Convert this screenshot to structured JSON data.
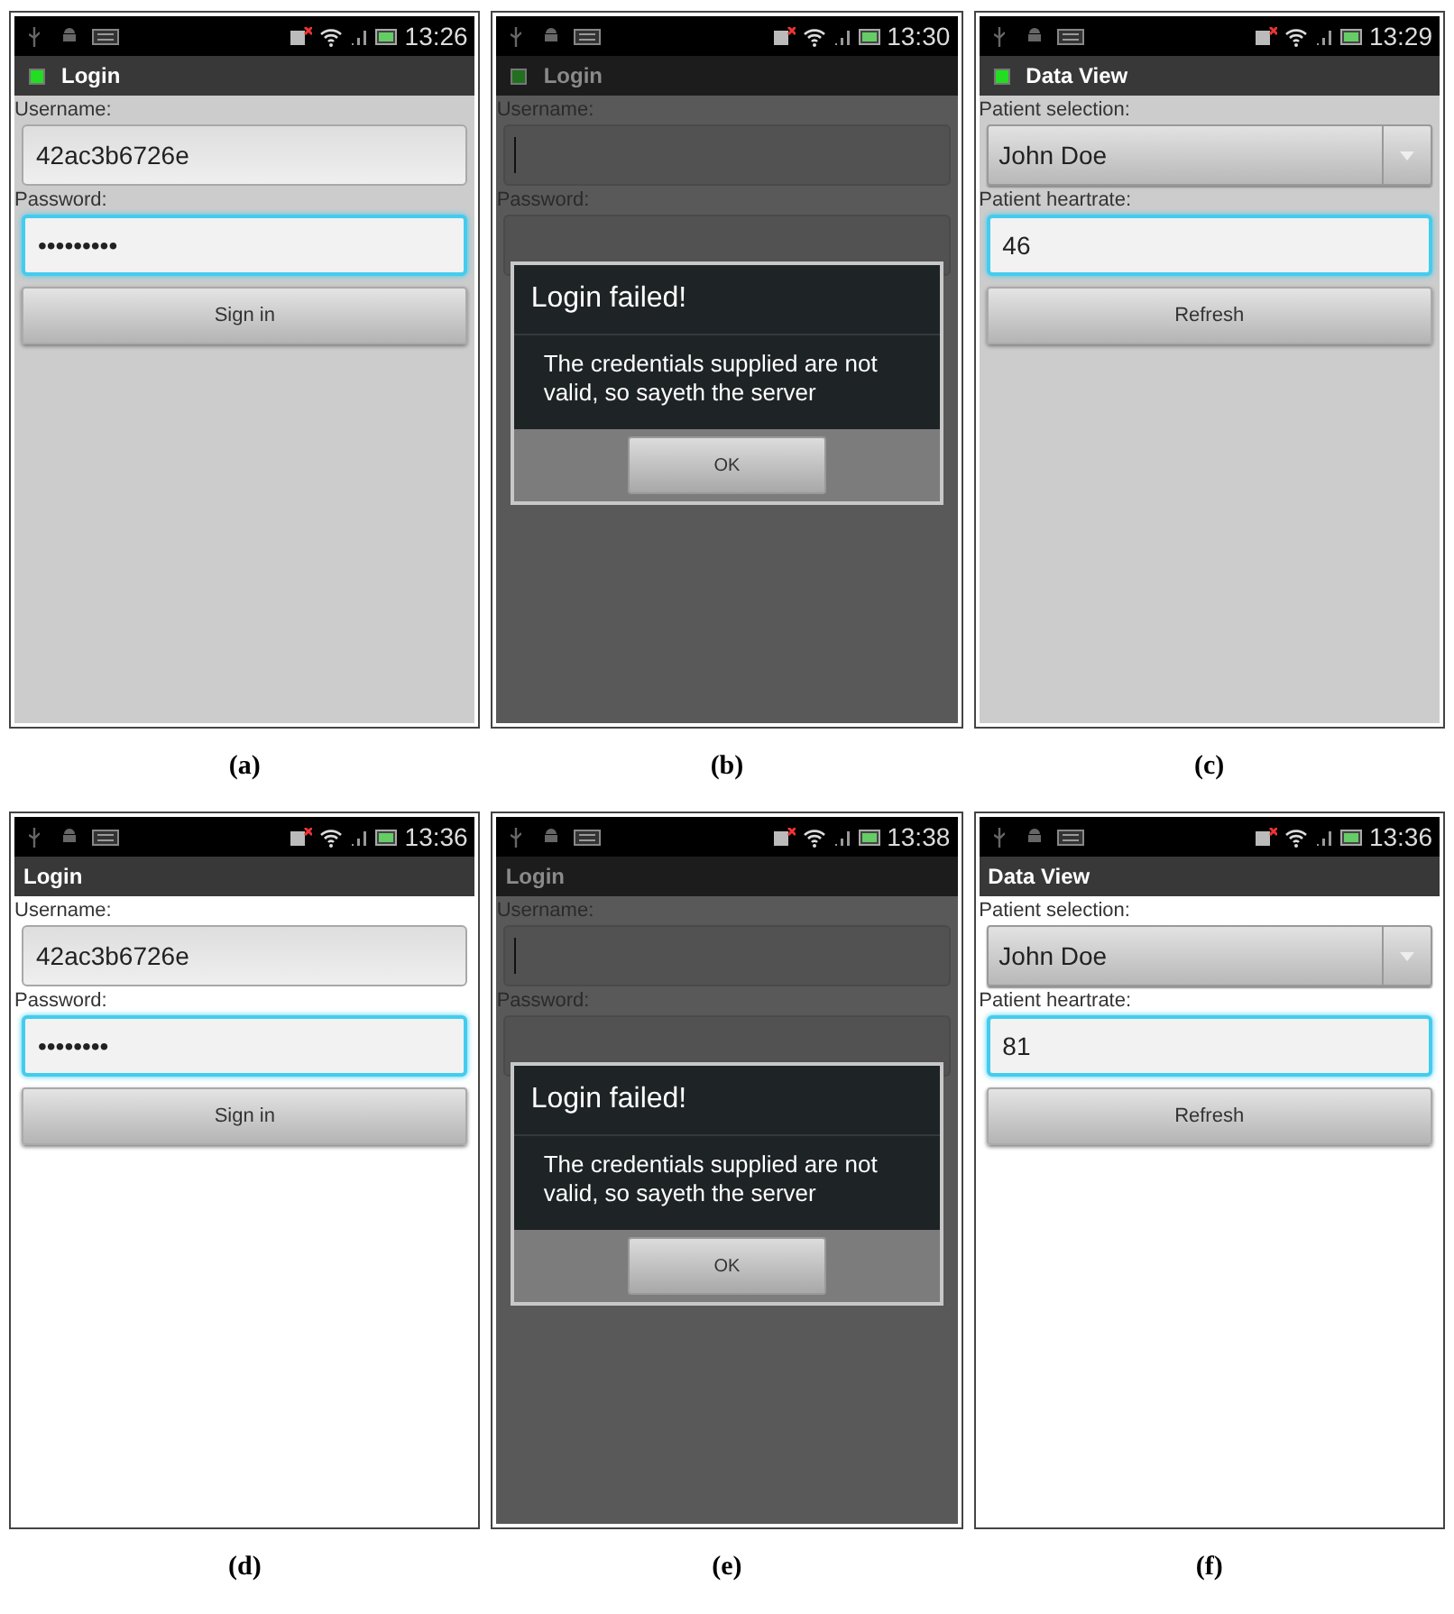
{
  "figures": [
    {
      "caption": "(a)",
      "status_bar": {
        "time": "13:26"
      },
      "title_bar": {
        "title": "Login",
        "app_icon": true
      },
      "light_background": false,
      "fields": [
        {
          "kind": "text",
          "label": "Username:",
          "value": "42ac3b6726e",
          "focused": false
        },
        {
          "kind": "text",
          "label": "Password:",
          "value": "•••••••••",
          "focused": true
        }
      ],
      "button": "Sign in"
    },
    {
      "caption": "(b)",
      "status_bar": {
        "time": "13:30"
      },
      "title_bar": {
        "title": "Login",
        "app_icon": true
      },
      "fields": [
        {
          "kind": "text",
          "label": "Username:",
          "cursor": true,
          "focused": false
        },
        {
          "kind": "text",
          "label": "Password:",
          "focused": false
        }
      ],
      "dialog": {
        "title": "Login failed!",
        "message": "The credentials supplied are not valid, so sayeth the server",
        "button": "OK"
      }
    },
    {
      "caption": "(c)",
      "status_bar": {
        "time": "13:29"
      },
      "title_bar": {
        "title": "Data View",
        "app_icon": true
      },
      "light_background": false,
      "fields": [
        {
          "kind": "dropdown",
          "label": "Patient selection:",
          "value": "John Doe"
        },
        {
          "kind": "text",
          "label": "Patient heartrate:",
          "value": "46",
          "focused": true
        }
      ],
      "button": "Refresh"
    },
    {
      "caption": "(d)",
      "status_bar": {
        "time": "13:36"
      },
      "title_bar": {
        "title": "Login",
        "app_icon": false
      },
      "light_background": true,
      "fields": [
        {
          "kind": "text",
          "label": "Username:",
          "value": "42ac3b6726e",
          "focused": false
        },
        {
          "kind": "text",
          "label": "Password:",
          "value": "••••••••",
          "focused": true
        }
      ],
      "button": "Sign in"
    },
    {
      "caption": "(e)",
      "status_bar": {
        "time": "13:38"
      },
      "title_bar": {
        "title": "Login",
        "app_icon": false
      },
      "fields": [
        {
          "kind": "text",
          "label": "Username:",
          "cursor": true,
          "focused": false
        },
        {
          "kind": "text",
          "label": "Password:",
          "focused": false
        }
      ],
      "dialog": {
        "title": "Login failed!",
        "message": "The credentials supplied are not valid, so sayeth the server",
        "button": "OK"
      }
    },
    {
      "caption": "(f)",
      "status_bar": {
        "time": "13:36"
      },
      "title_bar": {
        "title": "Data View",
        "app_icon": false
      },
      "light_background": true,
      "fields": [
        {
          "kind": "dropdown",
          "label": "Patient selection:",
          "value": "John Doe"
        },
        {
          "kind": "text",
          "label": "Patient heartrate:",
          "value": "81",
          "focused": true
        }
      ],
      "button": "Refresh"
    }
  ]
}
